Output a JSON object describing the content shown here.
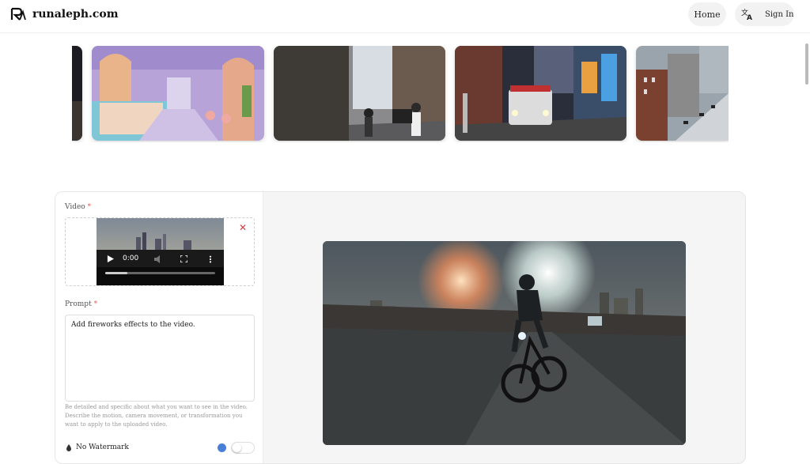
{
  "header": {
    "site_name": "runaleph.com",
    "home_label": "Home",
    "signin_label": "Sign In"
  },
  "carousel": {
    "items": [
      {
        "scene": "dark-edge"
      },
      {
        "scene": "pastel-cafe"
      },
      {
        "scene": "city-street"
      },
      {
        "scene": "police-car-night"
      },
      {
        "scene": "aerial-city"
      }
    ]
  },
  "form": {
    "video_label": "Video",
    "video_required": "*",
    "video_time": "0:00",
    "prompt_label": "Prompt",
    "prompt_required": "*",
    "prompt_value": "Add fireworks effects to the video.",
    "help_text": "Be detailed and specific about what you want to see in the video. Describe the motion, camera movement, or transformation you want to apply to the uploaded video.",
    "watermark_label": "No Watermark",
    "watermark_enabled": false
  },
  "colors": {
    "accent": "#4a7fd8",
    "required": "#e06060",
    "remove": "#d04040"
  },
  "icons": [
    "logo-icon",
    "translate-icon",
    "remove-video-icon",
    "play-icon",
    "volume-icon",
    "fullscreen-icon",
    "more-icon",
    "drop-icon",
    "premium-badge-icon"
  ]
}
